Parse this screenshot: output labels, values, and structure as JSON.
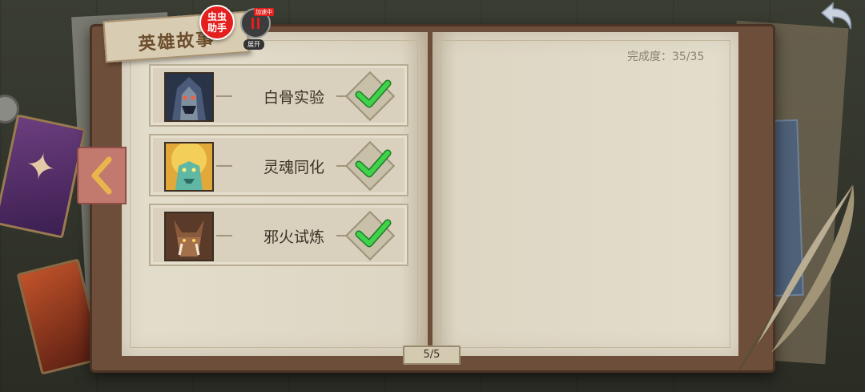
{
  "title_banner": {
    "text": "英雄故事"
  },
  "assistant": {
    "badge_label": "虫虫\n助手",
    "speed_tag": "加速中",
    "expand_label": "展开"
  },
  "completion": {
    "text": "完成度：35/35"
  },
  "stories": [
    {
      "title": "白骨实验",
      "completed": true,
      "portrait_icon": "hooded-undead-portrait-icon"
    },
    {
      "title": "灵魂同化",
      "completed": true,
      "portrait_icon": "golden-maned-beast-portrait-icon"
    },
    {
      "title": "邪火试炼",
      "completed": true,
      "portrait_icon": "boar-warrior-portrait-icon"
    }
  ],
  "pagination": {
    "indicator": "5/5"
  },
  "colors": {
    "check": "#3fd24a",
    "page": "#e3ddcc",
    "cover": "#6d4e3a",
    "tab": "#c2796e"
  }
}
